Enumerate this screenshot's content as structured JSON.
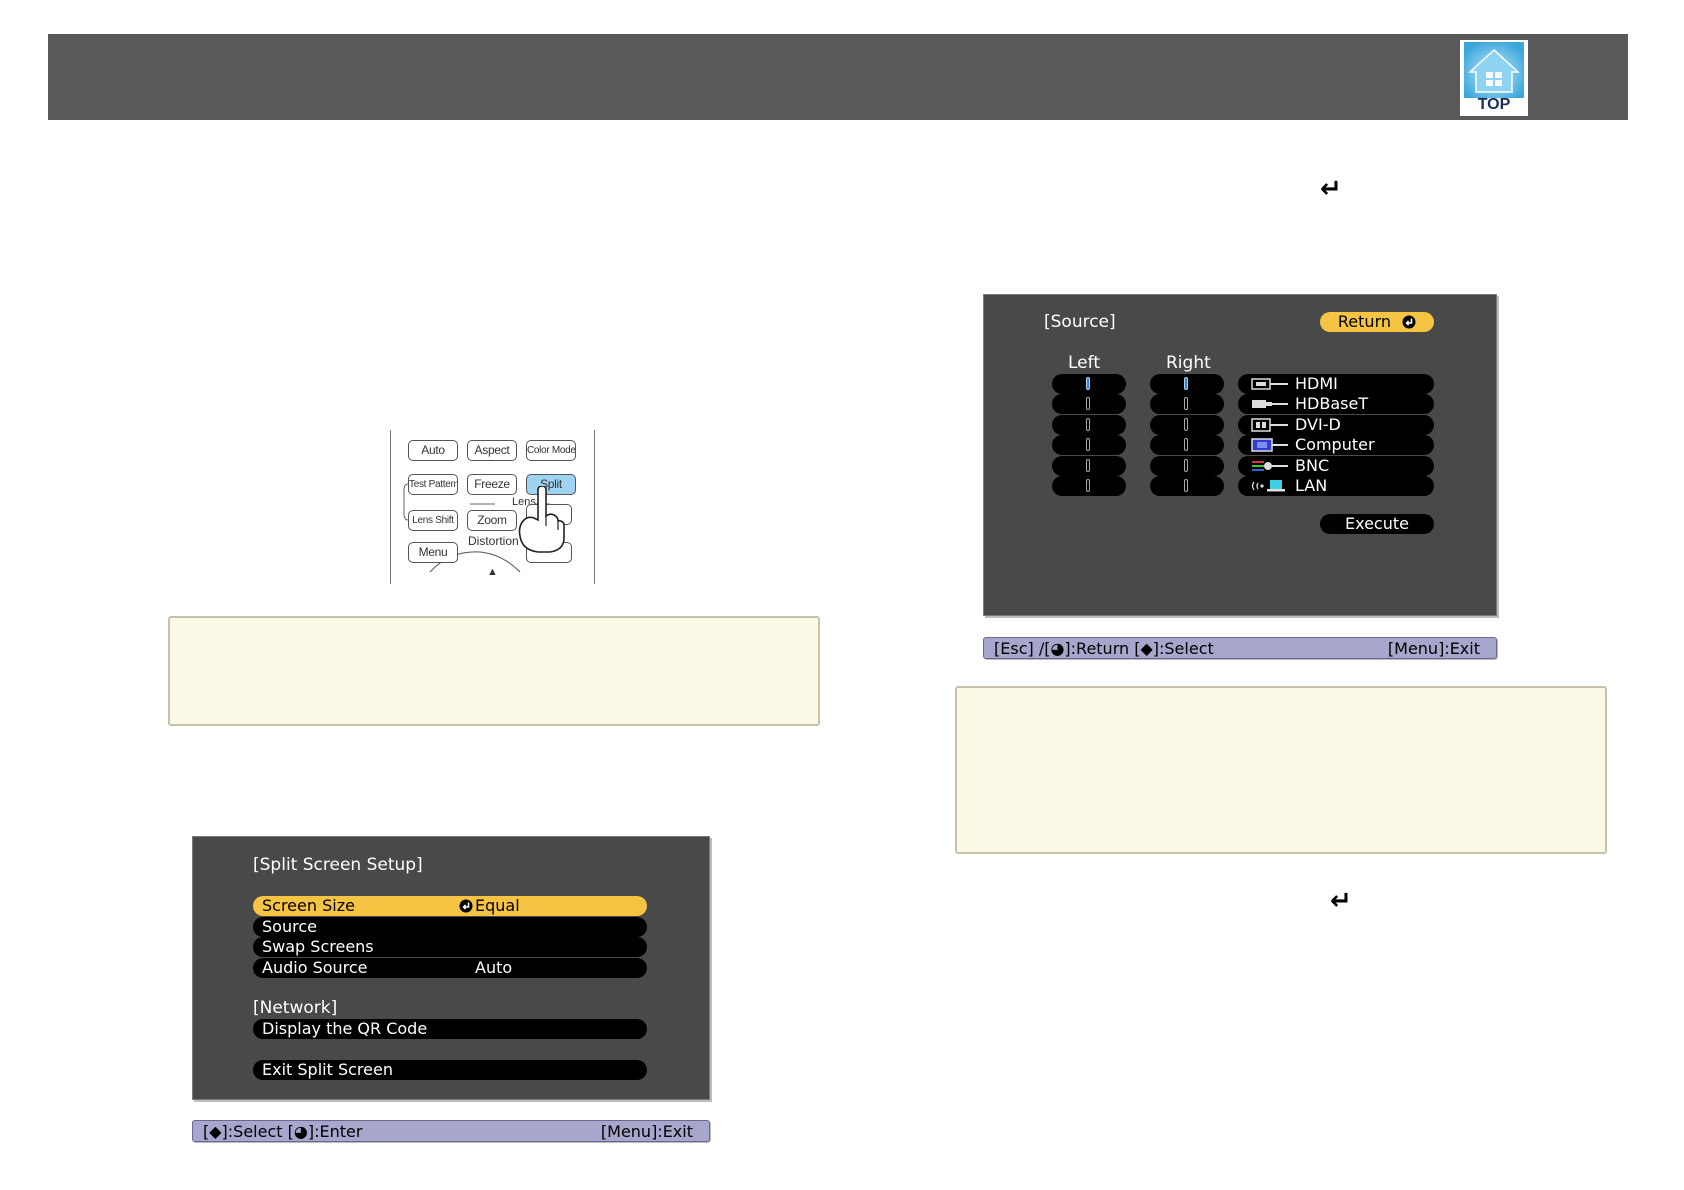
{
  "header": {
    "top_label": "TOP",
    "top_icon": "home-icon"
  },
  "enter_glyph": "↵",
  "remote": {
    "row1": [
      "Auto",
      "Aspect",
      "Color Mode"
    ],
    "row2": [
      "Test Pattern",
      "Freeze",
      "Split"
    ],
    "lens_label": "Lens",
    "row3": [
      "Lens Shift",
      "Zoom"
    ],
    "distortion_label": "Distortion",
    "menu_label": "Menu",
    "arrow": "▲"
  },
  "split_menu": {
    "title": "[Split Screen Setup]",
    "items": [
      {
        "label": "Screen Size",
        "value": "Equal",
        "selected": true
      },
      {
        "label": "Source",
        "value": ""
      },
      {
        "label": "Swap Screens",
        "value": ""
      },
      {
        "label": "Audio Source",
        "value": "Auto"
      }
    ],
    "network_title": "[Network]",
    "qr_label": "Display the QR Code",
    "exit_label": "Exit Split Screen",
    "help": {
      "left": "[◆]:Select  [◕]:Enter",
      "right": "[Menu]:Exit"
    }
  },
  "source_menu": {
    "title": "[Source]",
    "return_label": "Return",
    "left_header": "Left",
    "right_header": "Right",
    "sources": [
      {
        "name": "HDMI",
        "icon": "hdmi-icon"
      },
      {
        "name": "HDBaseT",
        "icon": "hdbaset-icon"
      },
      {
        "name": "DVI-D",
        "icon": "dvi-icon"
      },
      {
        "name": "Computer",
        "icon": "computer-icon"
      },
      {
        "name": "BNC",
        "icon": "bnc-icon"
      },
      {
        "name": "LAN",
        "icon": "lan-icon"
      }
    ],
    "left_selected": 0,
    "right_selected": 0,
    "execute_label": "Execute",
    "help": {
      "left": "[Esc] /[◕]:Return  [◆]:Select",
      "right": "[Menu]:Exit"
    }
  }
}
